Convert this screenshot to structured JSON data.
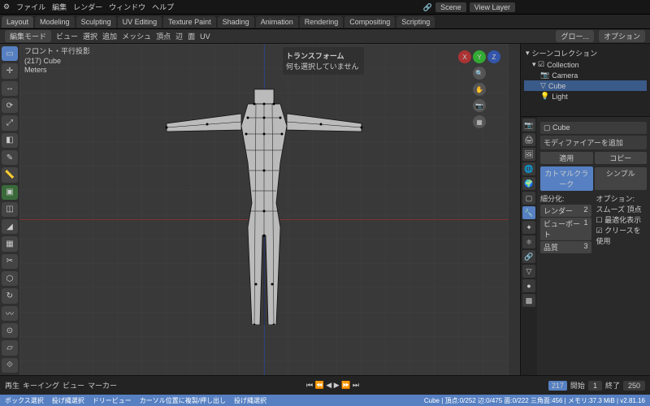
{
  "menu": {
    "logo": "⚙",
    "file": "ファイル",
    "edit": "編集",
    "render": "レンダー",
    "window": "ウィンドウ",
    "help": "ヘルプ"
  },
  "workspaces": {
    "layout": "Layout",
    "modeling": "Modeling",
    "sculpting": "Sculpting",
    "uv": "UV Editing",
    "texture": "Texture Paint",
    "shading": "Shading",
    "animation": "Animation",
    "rendering": "Rendering",
    "compositing": "Compositing",
    "scripting": "Scripting"
  },
  "scene": {
    "scene_label": "Scene",
    "viewlayer_label": "View Layer"
  },
  "header": {
    "mode": "編集モード",
    "view": "ビュー",
    "select": "選択",
    "add": "追加",
    "mesh": "メッシュ",
    "vertex": "頂点",
    "edge": "辺",
    "face": "面",
    "uv": "UV",
    "global": "グロー...",
    "options": "オプション"
  },
  "viewport": {
    "title": "フロント・平行投影",
    "obj": "(217) Cube",
    "units": "Meters"
  },
  "transform": {
    "title": "トランスフォーム",
    "msg": "何も選択していません"
  },
  "outliner": {
    "title": "シーンコレクション",
    "collection": "Collection",
    "camera": "Camera",
    "cube": "Cube",
    "light": "Light"
  },
  "props": {
    "object": "Cube",
    "add_mod": "モディファイアーを追加",
    "apply": "適用",
    "copy": "コピー",
    "subsurf": "カトマルクラーク",
    "simple": "シンプル",
    "subdivide": "細分化:",
    "options_lbl": "オプション:",
    "viewport_lbl": "ビューポート",
    "render_lbl": "レンダー",
    "quality_lbl": "品質",
    "viewport_val": "1",
    "render_val": "2",
    "quality_val": "3",
    "smooth": "スムーズ 頂点",
    "optimal": "最適化表示",
    "crease": "クリースを使用"
  },
  "timeline": {
    "play": "再生",
    "keying": "キーイング",
    "view": "ビュー",
    "marker": "マーカー",
    "current": "217",
    "start_lbl": "開始",
    "start": "1",
    "end_lbl": "終了",
    "end": "250"
  },
  "status": {
    "box": "ボックス選択",
    "lasso": "投げ縄選択",
    "circle": "ドリービュー",
    "cursor": "カーソル位置に複製/押し出し",
    "lasso2": "投げ縄選択",
    "obj_stat": "Cube | 頂点:0/252  辺:0/475  面:0/222  三角面:456 | メモリ:37.3 MiB | v2.81.16"
  }
}
